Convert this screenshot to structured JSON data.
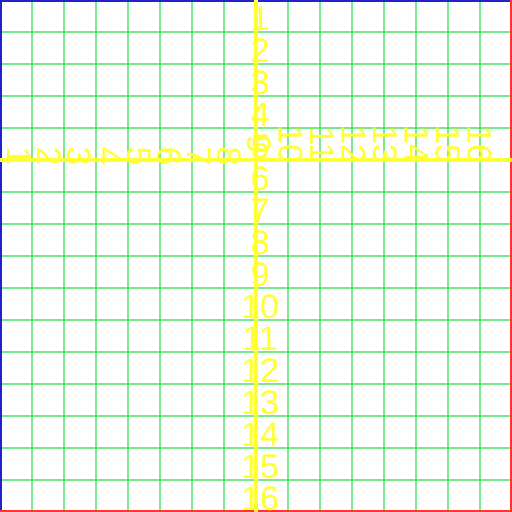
{
  "grid": {
    "cells": 16,
    "colors": {
      "background": "#ffffff",
      "grid_line": "#22dd44",
      "axis": "#ffff33",
      "numbers": "#ffff33",
      "top_border": "#2222cc",
      "left_border": "#2222cc",
      "bottom_border": "#ff3333",
      "right_border": "#ff3333"
    }
  },
  "vertical_labels": [
    "1",
    "2",
    "3",
    "4",
    "5",
    "6",
    "7",
    "8",
    "9",
    "10",
    "11",
    "12",
    "13",
    "14",
    "15",
    "16"
  ],
  "horizontal_labels": [
    "1",
    "2",
    "3",
    "4",
    "5",
    "6",
    "7",
    "8",
    "9",
    "10",
    "11",
    "12",
    "13",
    "14",
    "15",
    "16"
  ]
}
